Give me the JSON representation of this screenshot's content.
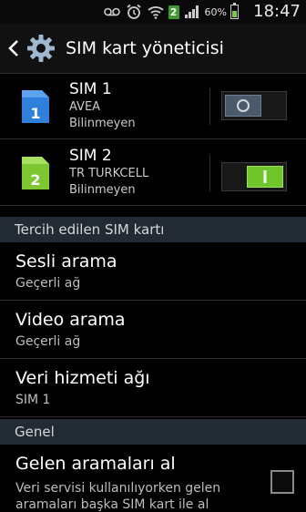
{
  "statusbar": {
    "signal_badge": "2",
    "battery_pct": "60%",
    "battery_level": 0.6,
    "time": "18:47",
    "icons": [
      "voicemail-icon",
      "alarm-icon",
      "wifi-icon",
      "signal-icon",
      "battery-icon"
    ]
  },
  "actionbar": {
    "title": "SIM kart yöneticisi"
  },
  "sims": [
    {
      "name": "SIM 1",
      "slot": "1",
      "carrier": "AVEA",
      "status": "Bilinmeyen",
      "color": "#2f7fdc",
      "enabled": false
    },
    {
      "name": "SIM 2",
      "slot": "2",
      "carrier": "TR TURKCELL",
      "status": "Bilinmeyen",
      "color": "#7dc832",
      "enabled": true
    }
  ],
  "sections": {
    "preferred": "Tercih edilen SIM kartı",
    "general": "Genel"
  },
  "settings": {
    "voice": {
      "title": "Sesli arama",
      "value": "Geçerli ağ"
    },
    "video": {
      "title": "Video arama",
      "value": "Geçerli ağ"
    },
    "data": {
      "title": "Veri hizmeti ağı",
      "value": "SIM 1"
    },
    "incoming": {
      "title": "Gelen aramaları al",
      "desc1": "Veri servisi kullanılıyorken gelen",
      "desc2": "aramaları başka SIM kart ile al",
      "checked": false
    }
  },
  "colors": {
    "toggle_on": "#6fc52a",
    "toggle_off": "#4a5a6a",
    "section_bg": "#222a33"
  }
}
